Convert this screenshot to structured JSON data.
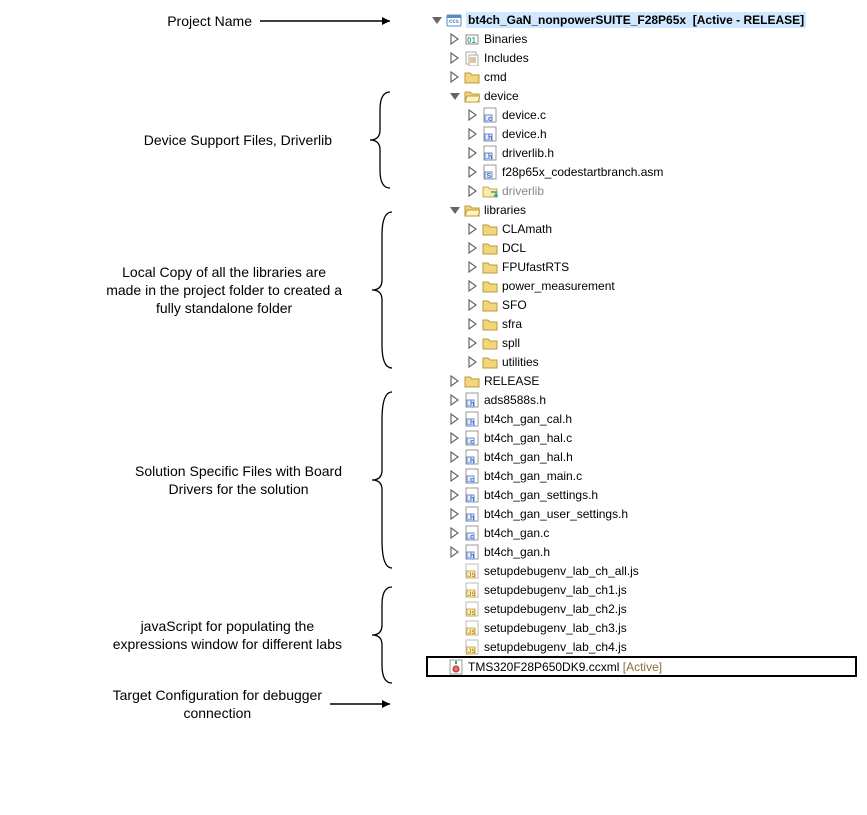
{
  "labels": {
    "project_name": "Project Name",
    "device_support": "Device Support Files, Driverlib",
    "local_copy": "Local Copy of all the libraries are\nmade in the project folder to created a\nfully standalone folder",
    "solution_files": "Solution Specific Files with Board\nDrivers for the solution",
    "javascript_labs": "javaScript for populating the\nexpressions window for different labs",
    "target_config": "Target Configuration for debugger\nconnection"
  },
  "project": {
    "name": "bt4ch_GaN_nonpowerSUITE_F28P65x",
    "status": "[Active - RELEASE]"
  },
  "tree": {
    "binaries": "Binaries",
    "includes": "Includes",
    "cmd": "cmd",
    "device": "device",
    "device_c": "device.c",
    "device_h": "device.h",
    "driverlib_h": "driverlib.h",
    "codestart": "f28p65x_codestartbranch.asm",
    "driverlib_folder": "driverlib",
    "libraries": "libraries",
    "clamath": "CLAmath",
    "dcl": "DCL",
    "fpufastrts": "FPUfastRTS",
    "power_measurement": "power_measurement",
    "sfo": "SFO",
    "sfra": "sfra",
    "spll": "spll",
    "utilities": "utilities",
    "release": "RELEASE",
    "ads8588s_h": "ads8588s.h",
    "cal_h": "bt4ch_gan_cal.h",
    "hal_c": "bt4ch_gan_hal.c",
    "hal_h": "bt4ch_gan_hal.h",
    "main_c": "bt4ch_gan_main.c",
    "settings_h": "bt4ch_gan_settings.h",
    "user_settings_h": "bt4ch_gan_user_settings.h",
    "gan_c": "bt4ch_gan.c",
    "gan_h": "bt4ch_gan.h",
    "js_all": "setupdebugenv_lab_ch_all.js",
    "js_ch1": "setupdebugenv_lab_ch1.js",
    "js_ch2": "setupdebugenv_lab_ch2.js",
    "js_ch3": "setupdebugenv_lab_ch3.js",
    "js_ch4": "setupdebugenv_lab_ch4.js",
    "ccxml": "TMS320F28P650DK9.ccxml",
    "ccxml_status": "[Active]"
  }
}
